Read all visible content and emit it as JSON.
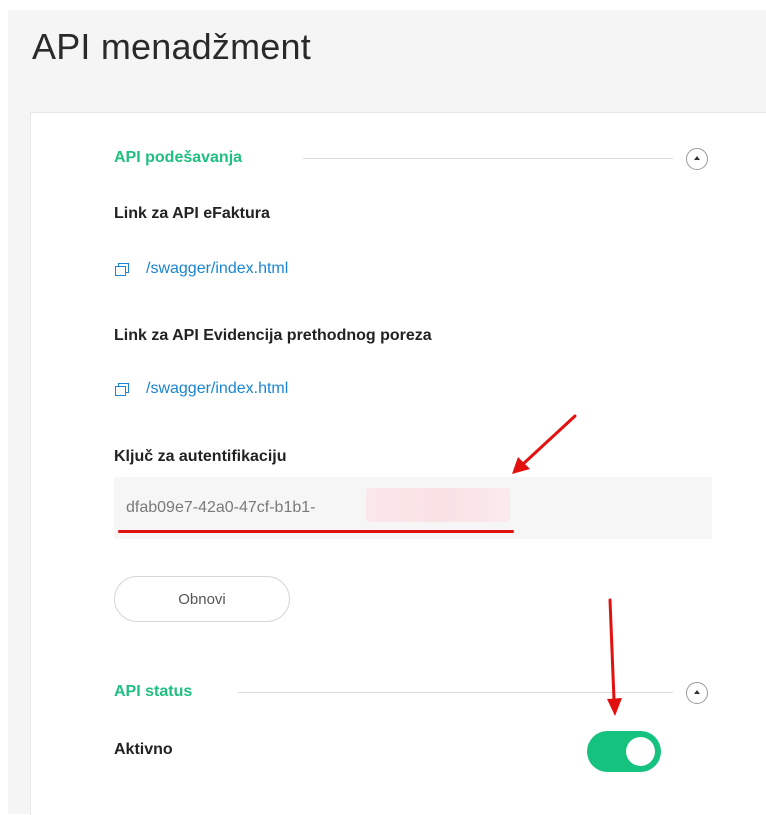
{
  "page": {
    "title": "API menadžment"
  },
  "api_settings": {
    "section_title": "API podešavanja",
    "efaktura": {
      "label": "Link za API eFaktura",
      "link": "/swagger/index.html",
      "icon": "copy-icon"
    },
    "evidencija": {
      "label": "Link za API Evidencija prethodnog poreza",
      "link": "/swagger/index.html",
      "icon": "copy-icon"
    },
    "auth_key": {
      "label": "Ključ za autentifikaciju",
      "value": "dfab09e7-42a0-47cf-b1b1-"
    },
    "refresh_button": "Obnovi"
  },
  "api_status": {
    "section_title": "API status",
    "active_label": "Aktivno",
    "active": true
  },
  "colors": {
    "accent_green": "#1fbf7f",
    "toggle_on": "#15c27e",
    "link_blue": "#1a85d6",
    "annotation_red": "#e31010"
  }
}
